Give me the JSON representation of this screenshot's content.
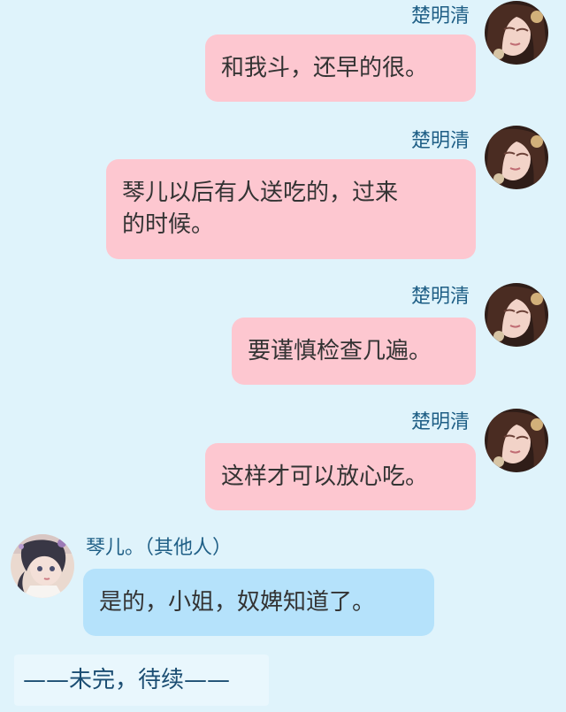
{
  "messages": [
    {
      "sender": "楚明清",
      "text": "和我斗，还早的很。",
      "avatar": "avatar-chu-mingqing-icon"
    },
    {
      "sender": "楚明清",
      "text": "琴儿以后有人送吃的，过来\n的时候。",
      "avatar": "avatar-chu-mingqing-icon"
    },
    {
      "sender": "楚明清",
      "text": "要谨慎检查几遍。",
      "avatar": "avatar-chu-mingqing-icon"
    },
    {
      "sender": "楚明清",
      "text": "这样才可以放心吃。",
      "avatar": "avatar-chu-mingqing-icon"
    },
    {
      "sender": "琴儿。（其他人）",
      "text": "是的，小姐，奴婢知道了。",
      "avatar": "avatar-qin-er-icon"
    }
  ],
  "footer": {
    "text": "——未完，待续——"
  },
  "colors": {
    "background": "#dff3fb",
    "right_bubble": "#fdc7d0",
    "left_bubble": "#b5e2fb",
    "name": "#1f5f86"
  }
}
